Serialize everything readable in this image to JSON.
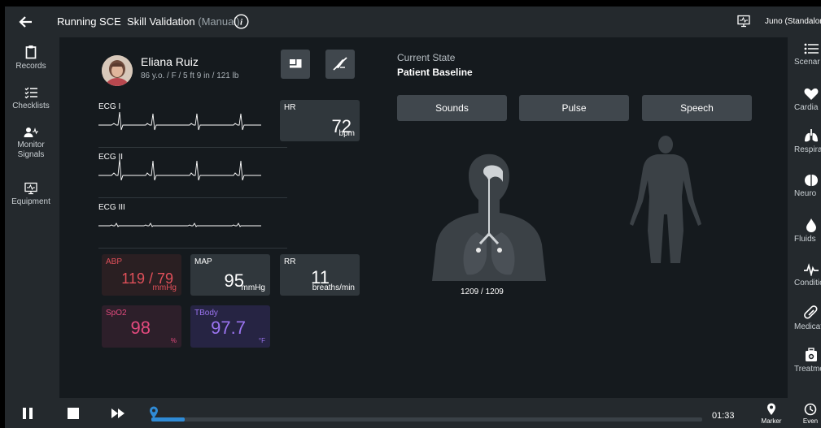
{
  "topbar": {
    "title_prefix": "Running SCE",
    "title_main": "Skill Validation",
    "title_mode": "(Manual)",
    "device": "Juno (Standalon"
  },
  "left_nav": [
    {
      "label": "Records",
      "icon": "clipboard-icon"
    },
    {
      "label": "Checklists",
      "icon": "checklist-icon"
    },
    {
      "label": "Monitor Signals",
      "icon": "monitor-signals-icon"
    },
    {
      "label": "Equipment",
      "icon": "equipment-icon"
    }
  ],
  "right_nav": [
    {
      "label": "Scenar",
      "icon": "list-icon"
    },
    {
      "label": "Cardia",
      "icon": "heart-icon"
    },
    {
      "label": "Respirat",
      "icon": "lungs-icon"
    },
    {
      "label": "Neuro",
      "icon": "brain-icon"
    },
    {
      "label": "Fluids",
      "icon": "drop-icon"
    },
    {
      "label": "Conditio",
      "icon": "pulse-wave-icon"
    },
    {
      "label": "Medicati",
      "icon": "pill-icon"
    },
    {
      "label": "Treatme",
      "icon": "medkit-icon"
    }
  ],
  "patient": {
    "name": "Eliana Ruiz",
    "info": "86 y.o. / F / 5 ft 9 in / 121 lb"
  },
  "ecg": [
    {
      "label": "ECG I"
    },
    {
      "label": "ECG II"
    },
    {
      "label": "ECG III"
    }
  ],
  "vitals": {
    "hr": {
      "label": "HR",
      "value": "72",
      "unit": "bpm"
    },
    "abp": {
      "label": "ABP",
      "value": "119 / 79",
      "unit": "mmHg"
    },
    "map": {
      "label": "MAP",
      "value": "95",
      "unit": "mmHg"
    },
    "rr": {
      "label": "RR",
      "value": "11",
      "unit": "breaths/min"
    },
    "spo2": {
      "label": "SpO2",
      "value": "98",
      "unit": "%"
    },
    "tbody": {
      "label": "TBody",
      "value": "97.7",
      "unit": "°F"
    }
  },
  "state": {
    "label": "Current State",
    "value": "Patient Baseline"
  },
  "controls": {
    "sounds": "Sounds",
    "pulse": "Pulse",
    "speech": "Speech"
  },
  "respiratory_count": "1209 / 1209",
  "playback": {
    "time": "01:33",
    "progress": 0.06,
    "marker_label": "Marker",
    "event_label": "Even"
  },
  "colors": {
    "abp": "#e0505a",
    "spo2": "#e34a7e",
    "tbody": "#9b74f0",
    "progress": "#2f8bd6"
  }
}
